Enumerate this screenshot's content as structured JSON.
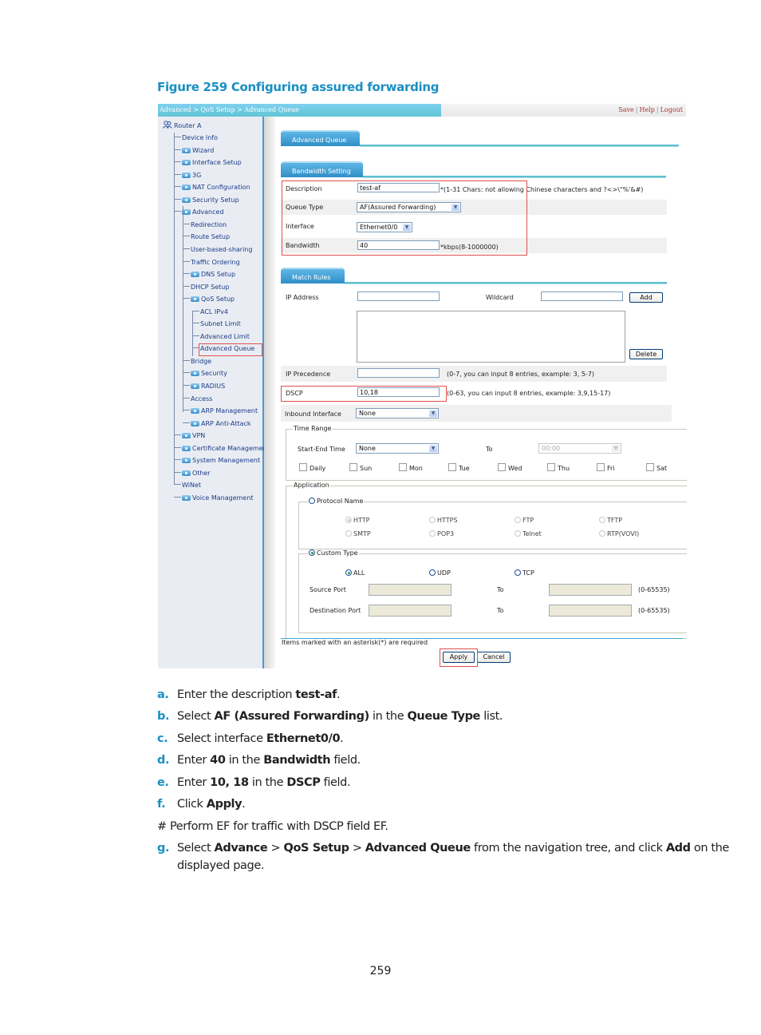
{
  "figure_title": "Figure 259 Configuring assured forwarding",
  "ui": {
    "breadcrumb": "Advanced > QoS Setup > Advanced Queue",
    "top_links": [
      "Save",
      "Help",
      "Logout"
    ],
    "tree": {
      "root": "Router A",
      "items": [
        {
          "label": "Device Info",
          "folder": false,
          "level": 1
        },
        {
          "label": "Wizard",
          "folder": true,
          "level": 1
        },
        {
          "label": "Interface Setup",
          "folder": true,
          "level": 1
        },
        {
          "label": "3G",
          "folder": true,
          "level": 1
        },
        {
          "label": "NAT Configuration",
          "folder": true,
          "level": 1
        },
        {
          "label": "Security Setup",
          "folder": true,
          "level": 1
        },
        {
          "label": "Advanced",
          "folder": true,
          "level": 1
        },
        {
          "label": "Redirection",
          "folder": false,
          "level": 2
        },
        {
          "label": "Route Setup",
          "folder": false,
          "level": 2
        },
        {
          "label": "User-based-sharing",
          "folder": false,
          "level": 2
        },
        {
          "label": "Traffic Ordering",
          "folder": false,
          "level": 2
        },
        {
          "label": "DNS Setup",
          "folder": true,
          "level": 2
        },
        {
          "label": "DHCP Setup",
          "folder": false,
          "level": 2
        },
        {
          "label": "QoS Setup",
          "folder": true,
          "level": 2
        },
        {
          "label": "ACL IPv4",
          "folder": false,
          "level": 3
        },
        {
          "label": "Subnet Limit",
          "folder": false,
          "level": 3
        },
        {
          "label": "Advanced Limit",
          "folder": false,
          "level": 3
        },
        {
          "label": "Advanced Queue",
          "folder": false,
          "level": 3,
          "selected": true
        },
        {
          "label": "Bridge",
          "folder": false,
          "level": 2
        },
        {
          "label": "Security",
          "folder": true,
          "level": 2
        },
        {
          "label": "RADIUS",
          "folder": true,
          "level": 2
        },
        {
          "label": "Access",
          "folder": false,
          "level": 2
        },
        {
          "label": "ARP Management",
          "folder": true,
          "level": 2
        },
        {
          "label": "ARP Anti-Attack",
          "folder": true,
          "level": 2
        },
        {
          "label": "VPN",
          "folder": true,
          "level": 1
        },
        {
          "label": "Certificate Managemer",
          "folder": true,
          "level": 1
        },
        {
          "label": "System Management",
          "folder": true,
          "level": 1
        },
        {
          "label": "Other",
          "folder": true,
          "level": 1
        },
        {
          "label": "WiNet",
          "folder": false,
          "level": 1
        },
        {
          "label": "Voice Management",
          "folder": true,
          "level": 1
        }
      ]
    },
    "tabs": {
      "advanced_queue": "Advanced Queue",
      "bandwidth_setting": "Bandwidth Setting",
      "match_rules": "Match Rules"
    },
    "bandwidth": {
      "description_label": "Description",
      "description_value": "test-af",
      "description_hint": "*(1-31 Chars: not allowing Chinese characters and ?<>\\\"%'&#)",
      "queue_type_label": "Queue Type",
      "queue_type_value": "AF(Assured Forwarding)",
      "interface_label": "Interface",
      "interface_value": "Ethernet0/0",
      "bandwidth_label": "Bandwidth",
      "bandwidth_value": "40",
      "bandwidth_hint": "*kbps(8-1000000)"
    },
    "match": {
      "ip_address_label": "IP Address",
      "ip_address_value": "",
      "wildcard_label": "Wildcard",
      "wildcard_value": "",
      "add_button": "Add",
      "delete_button": "Delete",
      "ip_precedence_label": "IP Precedence",
      "ip_precedence_value": "",
      "ip_precedence_hint": "(0-7, you can input 8 entries, example: 3, 5-7)",
      "dscp_label": "DSCP",
      "dscp_value": "10,18",
      "dscp_hint": "(0-63, you can input 8 entries, example: 3,9,15-17)",
      "inbound_label": "Inbound Interface",
      "inbound_value": "None"
    },
    "time_range": {
      "legend": "Time Range",
      "start_end_label": "Start-End Time",
      "start_value": "None",
      "to_label": "To",
      "end_value": "00:00",
      "days": [
        "Daily",
        "Sun",
        "Mon",
        "Tue",
        "Wed",
        "Thu",
        "Fri",
        "Sat"
      ]
    },
    "application": {
      "legend": "Application",
      "protocol_name_legend": "Protocol Name",
      "protocols": [
        "HTTP",
        "HTTPS",
        "FTP",
        "TFTP",
        "SMTP",
        "POP3",
        "Telnet",
        "RTP(VOVI)"
      ],
      "custom_type_legend": "Custom Type",
      "custom_options": [
        "ALL",
        "UDP",
        "TCP"
      ],
      "source_port_label": "Source Port",
      "destination_port_label": "Destination Port",
      "to_label": "To",
      "port_range_hint": "(0-65535)"
    },
    "required_note": "Items marked with an asterisk(*) are required",
    "apply_button": "Apply",
    "cancel_button": "Cancel"
  },
  "steps": [
    {
      "letter": "a.",
      "parts": [
        [
          "Enter the description ",
          false
        ],
        [
          "test-af",
          true
        ],
        [
          ".",
          false
        ]
      ]
    },
    {
      "letter": "b.",
      "parts": [
        [
          "Select ",
          false
        ],
        [
          "AF (Assured Forwarding)",
          true
        ],
        [
          " in the ",
          false
        ],
        [
          "Queue Type",
          true
        ],
        [
          " list.",
          false
        ]
      ]
    },
    {
      "letter": "c.",
      "parts": [
        [
          "Select interface ",
          false
        ],
        [
          "Ethernet0/0",
          true
        ],
        [
          ".",
          false
        ]
      ]
    },
    {
      "letter": "d.",
      "parts": [
        [
          "Enter ",
          false
        ],
        [
          "40",
          true
        ],
        [
          " in the ",
          false
        ],
        [
          "Bandwidth",
          true
        ],
        [
          " field.",
          false
        ]
      ]
    },
    {
      "letter": "e.",
      "parts": [
        [
          "Enter ",
          false
        ],
        [
          "10, 18",
          true
        ],
        [
          " in the ",
          false
        ],
        [
          "DSCP",
          true
        ],
        [
          " field.",
          false
        ]
      ]
    },
    {
      "letter": "f.",
      "parts": [
        [
          "Click ",
          false
        ],
        [
          "Apply",
          true
        ],
        [
          ".",
          false
        ]
      ]
    },
    {
      "letter": "",
      "parts": [
        [
          "# Perform EF for traffic with DSCP field EF.",
          false
        ]
      ]
    },
    {
      "letter": "g.",
      "parts": [
        [
          "Select ",
          false
        ],
        [
          "Advance",
          true
        ],
        [
          " > ",
          false
        ],
        [
          "QoS Setup",
          true
        ],
        [
          " > ",
          false
        ],
        [
          "Advanced Queue",
          true
        ],
        [
          " from the navigation tree, and click ",
          false
        ],
        [
          "Add",
          true
        ],
        [
          " on the",
          false
        ]
      ]
    },
    {
      "letter": "",
      "parts": [
        [
          "displayed page.",
          false
        ]
      ],
      "indent": true
    }
  ],
  "page_number": "259",
  "colors": {
    "accent": "#1a8fc2",
    "tab_blue": "#2f8fc8",
    "highlight_red": "#e05050",
    "link_red": "#aa3333"
  }
}
